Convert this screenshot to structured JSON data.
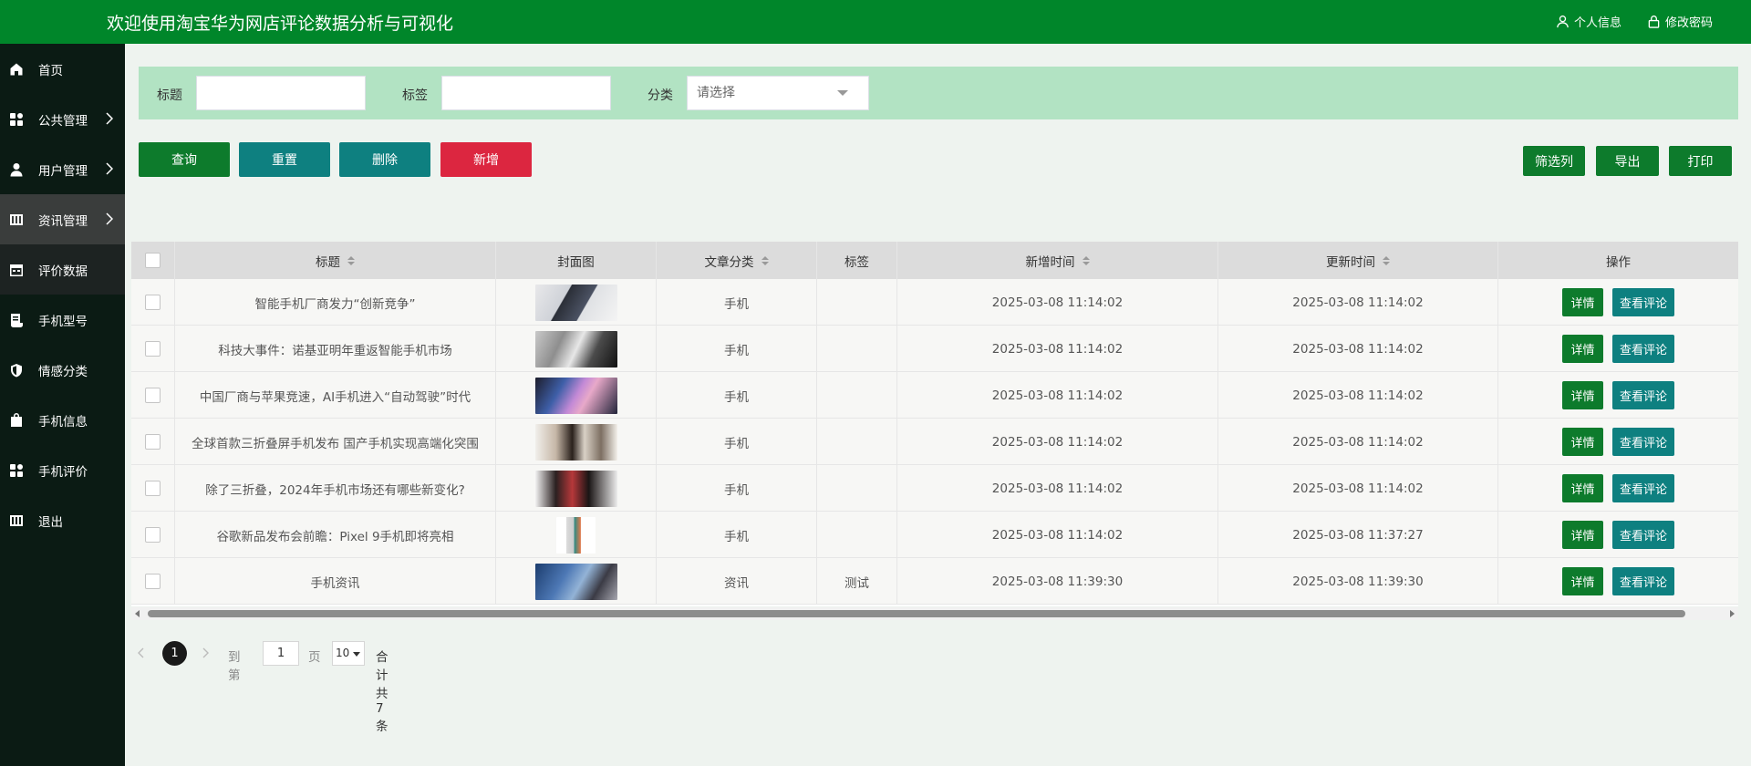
{
  "header": {
    "title": "欢迎使用淘宝华为网店评论数据分析与可视化",
    "profile_label": "个人信息",
    "password_label": "修改密码",
    "bg_color": "#00862a"
  },
  "sidebar": {
    "items": [
      {
        "label": "首页",
        "icon": "home-icon"
      },
      {
        "label": "公共管理",
        "icon": "grid-icon"
      },
      {
        "label": "用户管理",
        "icon": "user-icon"
      },
      {
        "label": "资讯管理",
        "icon": "news-icon"
      },
      {
        "label": "评价数据",
        "icon": "calendar-icon"
      },
      {
        "label": "手机型号",
        "icon": "scroll-icon"
      },
      {
        "label": "情感分类",
        "icon": "shield-icon"
      },
      {
        "label": "手机信息",
        "icon": "bag-icon"
      },
      {
        "label": "手机评价",
        "icon": "grid-icon"
      },
      {
        "label": "退出",
        "icon": "news-icon"
      }
    ]
  },
  "search": {
    "title_label": "标题",
    "title_value": "",
    "tag_label": "标签",
    "tag_value": "",
    "category_label": "分类",
    "category_placeholder": "请选择"
  },
  "toolbar": {
    "query": "查询",
    "reset": "重置",
    "delete": "删除",
    "add": "新增",
    "filter_columns": "筛选列",
    "export": "导出",
    "print": "打印"
  },
  "table": {
    "columns": [
      "标题",
      "封面图",
      "文章分类",
      "标签",
      "新增时间",
      "更新时间",
      "操作"
    ],
    "rows": [
      {
        "title": "智能手机厂商发力“创新竞争”",
        "category": "手机",
        "tag": "",
        "created": "2025-03-08 11:14:02",
        "updated": "2025-03-08 11:14:02"
      },
      {
        "title": "科技大事件：诺基亚明年重返智能手机市场",
        "category": "手机",
        "tag": "",
        "created": "2025-03-08 11:14:02",
        "updated": "2025-03-08 11:14:02"
      },
      {
        "title": "中国厂商与苹果竞速，AI手机进入“自动驾驶”时代",
        "category": "手机",
        "tag": "",
        "created": "2025-03-08 11:14:02",
        "updated": "2025-03-08 11:14:02"
      },
      {
        "title": "全球首款三折叠屏手机发布 国产手机实现高端化突围",
        "category": "手机",
        "tag": "",
        "created": "2025-03-08 11:14:02",
        "updated": "2025-03-08 11:14:02"
      },
      {
        "title": "除了三折叠，2024年手机市场还有哪些新变化?",
        "category": "手机",
        "tag": "",
        "created": "2025-03-08 11:14:02",
        "updated": "2025-03-08 11:14:02"
      },
      {
        "title": "谷歌新品发布会前瞻：Pixel 9手机即将亮相",
        "category": "手机",
        "tag": "",
        "created": "2025-03-08 11:14:02",
        "updated": "2025-03-08 11:37:27"
      },
      {
        "title": "手机资讯",
        "category": "资讯",
        "tag": "测试",
        "created": "2025-03-08 11:39:30",
        "updated": "2025-03-08 11:39:30"
      }
    ],
    "detail_label": "详情",
    "review_label": "查看评论"
  },
  "pagination": {
    "current_page": "1",
    "goto_label": "到第",
    "goto_value": "1",
    "page_unit": "页",
    "page_size": "10",
    "total_text": "合计共 7 条"
  }
}
